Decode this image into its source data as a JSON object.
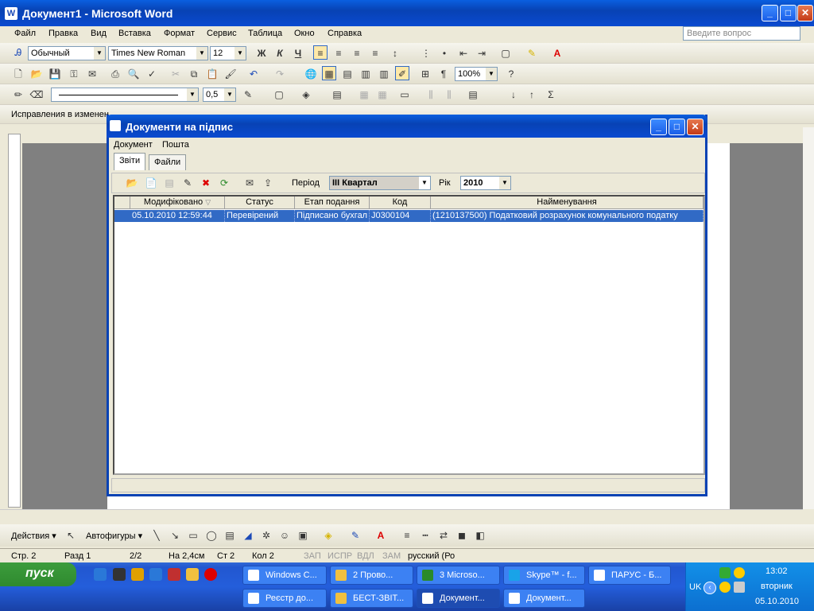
{
  "word": {
    "title": "Документ1 - Microsoft Word",
    "menu": [
      "Файл",
      "Правка",
      "Вид",
      "Вставка",
      "Формат",
      "Сервис",
      "Таблица",
      "Окно",
      "Справка"
    ],
    "ask_placeholder": "Введите вопрос",
    "style": "Обычный",
    "font": "Times New Roman",
    "size": "12",
    "zoom": "100%",
    "line_width": "0,5",
    "track_changes": "Исправления в изменен"
  },
  "dialog": {
    "title": "Документи на підпис",
    "menu": [
      "Документ",
      "Пошта"
    ],
    "tabs": [
      "Звіти",
      "Файли"
    ],
    "period_label": "Період",
    "period_value": "III Квартал",
    "year_label": "Рік",
    "year_value": "2010",
    "columns": [
      "Модифіковано",
      "Статус",
      "Етап подання",
      "Код",
      "Найменування"
    ],
    "rows": [
      {
        "modified": "05.10.2010 12:59:44",
        "status": "Перевірений",
        "stage": "Підписано бухгал",
        "code": "J0300104",
        "name": "(1210137500)  Податковий розрахунок комунального податку"
      }
    ]
  },
  "status": {
    "page": "Стр.  2",
    "section": "Разд  1",
    "pages": "2/2",
    "at": "На 2,4см",
    "line": "Ст  2",
    "col": "Кол  2",
    "rec": "ЗАП",
    "trk": "ИСПР",
    "ext": "ВДЛ",
    "ovr": "ЗАМ",
    "lang": "русский (Ро"
  },
  "drawbar": {
    "actions": "Действия ▾",
    "autoshapes": "Автофигуры ▾"
  },
  "taskbar": {
    "start": "пуск",
    "row1": [
      "Windows C...",
      "2 Прово...",
      "3 Microso...",
      "Skype™ - f...",
      "ПАРУС - Б..."
    ],
    "row2": [
      "Реєстр до...",
      "БЕСТ-ЗВІТ...",
      "Документ...",
      "Документ..."
    ],
    "lang": "UK",
    "time": "13:02",
    "day": "вторник",
    "date": "05.10.2010"
  }
}
